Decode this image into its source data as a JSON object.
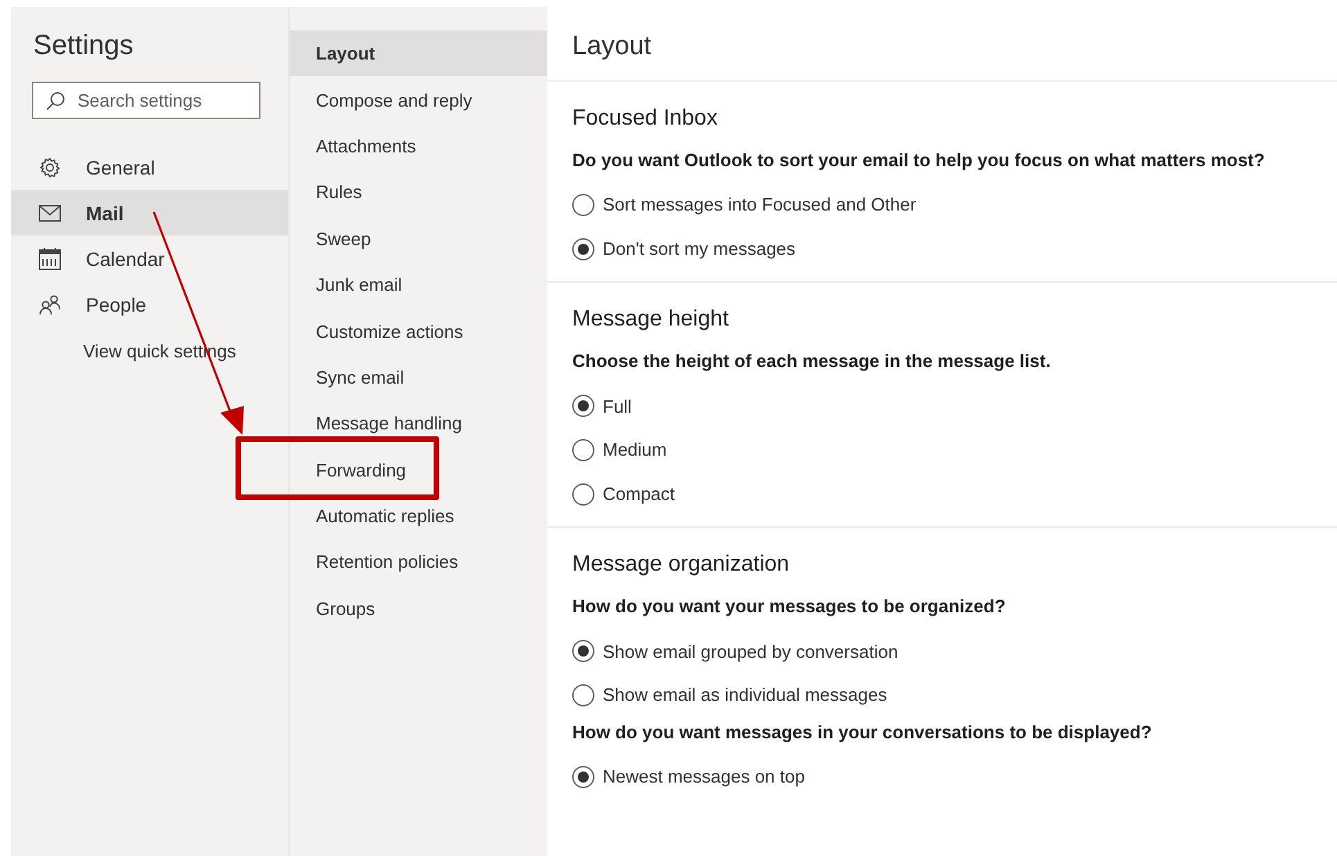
{
  "sidebar": {
    "title": "Settings",
    "search": {
      "placeholder": "Search settings"
    },
    "items": [
      {
        "label": "General",
        "selected": false
      },
      {
        "label": "Mail",
        "selected": true
      },
      {
        "label": "Calendar",
        "selected": false
      },
      {
        "label": "People",
        "selected": false
      }
    ],
    "quick_settings": "View quick settings"
  },
  "subnav": {
    "items": [
      {
        "label": "Layout",
        "selected": true
      },
      {
        "label": "Compose and reply",
        "selected": false
      },
      {
        "label": "Attachments",
        "selected": false
      },
      {
        "label": "Rules",
        "selected": false
      },
      {
        "label": "Sweep",
        "selected": false
      },
      {
        "label": "Junk email",
        "selected": false
      },
      {
        "label": "Customize actions",
        "selected": false
      },
      {
        "label": "Sync email",
        "selected": false
      },
      {
        "label": "Message handling",
        "selected": false
      },
      {
        "label": "Forwarding",
        "selected": false
      },
      {
        "label": "Automatic replies",
        "selected": false
      },
      {
        "label": "Retention policies",
        "selected": false
      },
      {
        "label": "Groups",
        "selected": false
      }
    ]
  },
  "pane": {
    "title": "Layout",
    "sections": [
      {
        "heading": "Focused Inbox",
        "groups": [
          {
            "question": "Do you want Outlook to sort your email to help you focus on what matters most?",
            "options": [
              {
                "label": "Sort messages into Focused and Other",
                "selected": false
              },
              {
                "label": "Don't sort my messages",
                "selected": true
              }
            ]
          }
        ]
      },
      {
        "heading": "Message height",
        "groups": [
          {
            "question": "Choose the height of each message in the message list.",
            "options": [
              {
                "label": "Full",
                "selected": true
              },
              {
                "label": "Medium",
                "selected": false
              },
              {
                "label": "Compact",
                "selected": false
              }
            ]
          }
        ]
      },
      {
        "heading": "Message organization",
        "groups": [
          {
            "question": "How do you want your messages to be organized?",
            "options": [
              {
                "label": "Show email grouped by conversation",
                "selected": true
              },
              {
                "label": "Show email as individual messages",
                "selected": false
              }
            ]
          },
          {
            "question": "How do you want messages in your conversations to be displayed?",
            "options": [
              {
                "label": "Newest messages on top",
                "selected": true
              }
            ]
          }
        ]
      }
    ]
  }
}
